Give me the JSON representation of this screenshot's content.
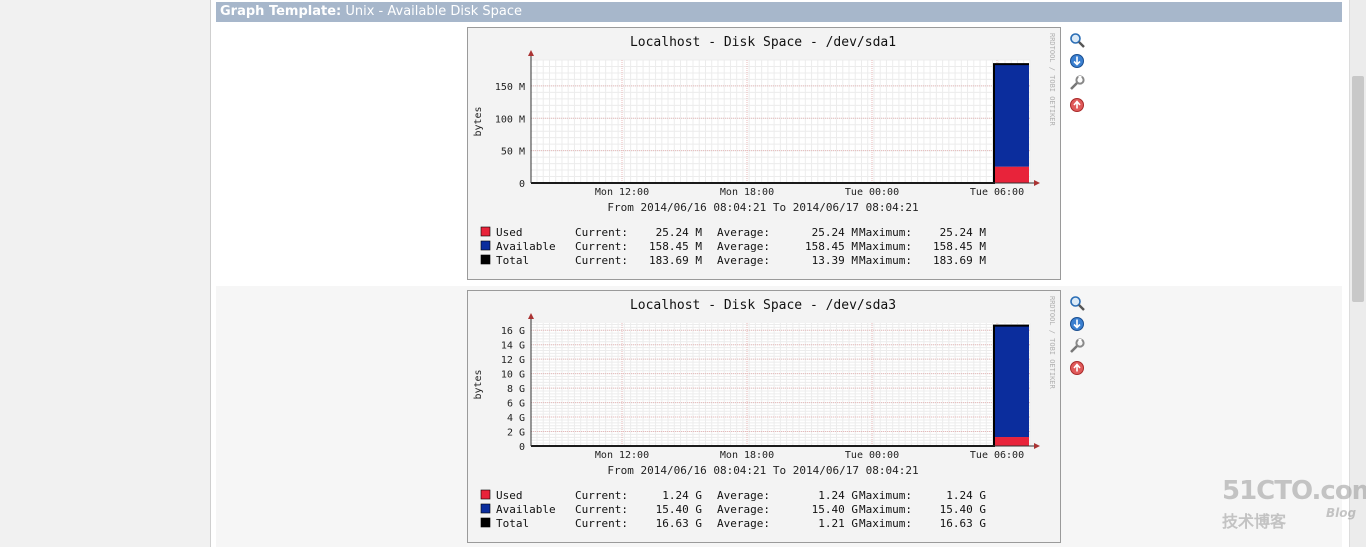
{
  "header": {
    "label": "Graph Template:",
    "value": "Unix - Available Disk Space"
  },
  "icons": [
    "zoom-icon",
    "download-icon",
    "edit-icon",
    "remove-icon"
  ],
  "watermark": {
    "text": "51CTO.com",
    "subtext": "技术博客",
    "blog": "Blog"
  },
  "colors": {
    "used": "#e8233a",
    "available": "#0b2d9d",
    "total": "#000000",
    "header_bg": "#a7b7cb"
  },
  "graphs": [
    {
      "title": "Localhost - Disk Space - /dev/sda1",
      "ylabel": "bytes",
      "yticks": [
        "0",
        "50 M",
        "100 M",
        "150 M"
      ],
      "xticks": [
        "Mon 12:00",
        "Mon 18:00",
        "Tue 00:00",
        "Tue 06:00"
      ],
      "range": "From 2014/06/16 08:04:21 To 2014/06/17 08:04:21",
      "side_text": "RRDTOOL / TOBI OETIKER",
      "legend": [
        {
          "name": "Used",
          "current": "25.24 M",
          "average": "25.24 M",
          "maximum": "25.24 M"
        },
        {
          "name": "Available",
          "current": "158.45 M",
          "average": "158.45 M",
          "maximum": "158.45 M"
        },
        {
          "name": "Total",
          "current": "183.69 M",
          "average": "13.39 M",
          "maximum": "183.69 M"
        }
      ],
      "legend_labels": {
        "current": "Current:",
        "average": "Average:",
        "maximum": "Maximum:"
      },
      "chart_data": {
        "type": "area",
        "ylim": [
          0,
          190
        ],
        "unit": "M",
        "series": [
          {
            "name": "Used",
            "values": [
              25.24
            ]
          },
          {
            "name": "Available",
            "values": [
              158.45
            ]
          },
          {
            "name": "Total",
            "values": [
              183.69
            ]
          }
        ]
      }
    },
    {
      "title": "Localhost - Disk Space - /dev/sda3",
      "ylabel": "bytes",
      "yticks": [
        "0",
        "2 G",
        "4 G",
        "6 G",
        "8 G",
        "10 G",
        "12 G",
        "14 G",
        "16 G"
      ],
      "xticks": [
        "Mon 12:00",
        "Mon 18:00",
        "Tue 00:00",
        "Tue 06:00"
      ],
      "range": "From 2014/06/16 08:04:21 To 2014/06/17 08:04:21",
      "side_text": "RRDTOOL / TOBI OETIKER",
      "legend": [
        {
          "name": "Used",
          "current": "1.24 G",
          "average": "1.24 G",
          "maximum": "1.24 G"
        },
        {
          "name": "Available",
          "current": "15.40 G",
          "average": "15.40 G",
          "maximum": "15.40 G"
        },
        {
          "name": "Total",
          "current": "16.63 G",
          "average": "1.21 G",
          "maximum": "16.63 G"
        }
      ],
      "legend_labels": {
        "current": "Current:",
        "average": "Average:",
        "maximum": "Maximum:"
      },
      "chart_data": {
        "type": "area",
        "ylim": [
          0,
          17
        ],
        "unit": "G",
        "series": [
          {
            "name": "Used",
            "values": [
              1.24
            ]
          },
          {
            "name": "Available",
            "values": [
              15.4
            ]
          },
          {
            "name": "Total",
            "values": [
              16.63
            ]
          }
        ]
      }
    }
  ]
}
